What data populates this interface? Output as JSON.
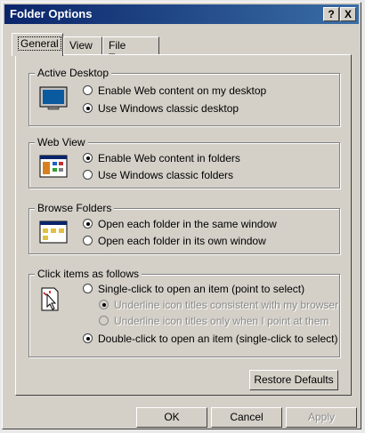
{
  "window": {
    "title": "Folder Options",
    "help_label": "?",
    "close_label": "X"
  },
  "tabs": [
    {
      "label": "General"
    },
    {
      "label": "View"
    },
    {
      "label": "File Types"
    }
  ],
  "active_desktop": {
    "label": "Active Desktop",
    "options": [
      {
        "label": "Enable Web content on my desktop",
        "checked": false
      },
      {
        "label": "Use Windows classic desktop",
        "checked": true
      }
    ]
  },
  "web_view": {
    "label": "Web View",
    "options": [
      {
        "label": "Enable Web content in folders",
        "checked": true
      },
      {
        "label": "Use Windows classic folders",
        "checked": false
      }
    ]
  },
  "browse_folders": {
    "label": "Browse Folders",
    "options": [
      {
        "label": "Open each folder in the same window",
        "checked": true
      },
      {
        "label": "Open each folder in its own window",
        "checked": false
      }
    ]
  },
  "click_items": {
    "label": "Click items as follows",
    "single_click": {
      "label": "Single-click to open an item (point to select)",
      "checked": false
    },
    "underline_consistent": {
      "label": "Underline icon titles consistent with my browser",
      "checked": true
    },
    "underline_point": {
      "label": "Underline icon titles only when I point at them",
      "checked": false
    },
    "double_click": {
      "label": "Double-click to open an item (single-click to select)",
      "checked": true
    }
  },
  "buttons": {
    "restore": "Restore Defaults",
    "ok": "OK",
    "cancel": "Cancel",
    "apply": "Apply"
  }
}
